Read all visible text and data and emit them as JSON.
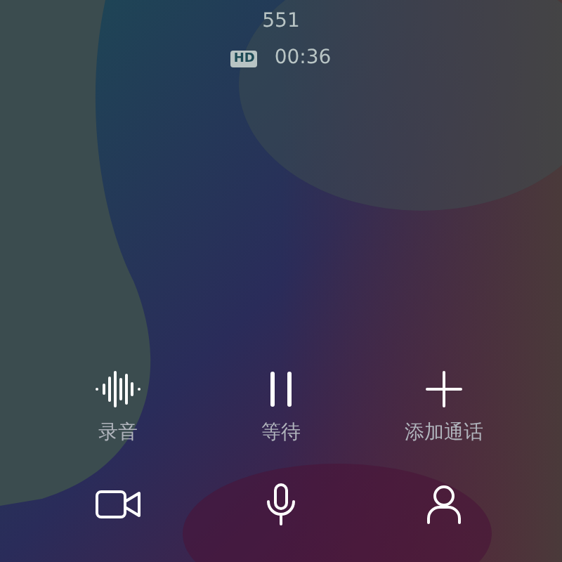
{
  "call": {
    "number": "551",
    "badge": "HD",
    "duration": "00:36"
  },
  "actions": [
    {
      "kind": "record",
      "label": "录音"
    },
    {
      "kind": "hold",
      "label": "等待"
    },
    {
      "kind": "add",
      "label": "添加通话"
    }
  ],
  "bottom_actions": [
    {
      "kind": "video"
    },
    {
      "kind": "mic"
    },
    {
      "kind": "contact"
    }
  ]
}
